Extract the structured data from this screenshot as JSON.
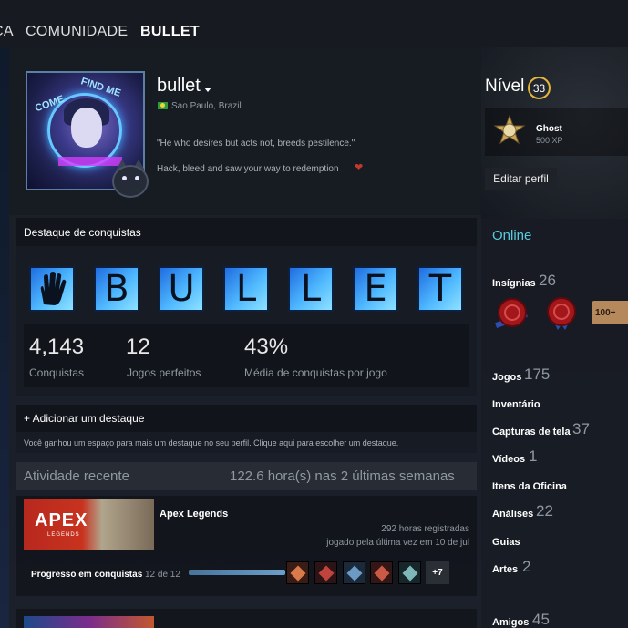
{
  "nav": {
    "item1": "CA",
    "item2": "COMUNIDADE",
    "item3": "BULLET"
  },
  "profile": {
    "username": "bullet",
    "location": "Sao Paulo, Brazil",
    "quote": "\"He who desires but acts not, breeds pestilence.\"",
    "summary_line": "Hack, bleed and saw your way to redemption"
  },
  "right": {
    "level_label": "Nível",
    "level": "33",
    "badge_name": "Ghost",
    "badge_xp": "500 XP",
    "edit_profile": "Editar perfil",
    "status": "Online",
    "badges_label": "Insígnias",
    "badges_count": "26",
    "badge_tag": "100+",
    "links": [
      {
        "label": "Jogos",
        "count": "175"
      },
      {
        "label": "Inventário",
        "count": ""
      },
      {
        "label": "Capturas de tela",
        "count": "37"
      },
      {
        "label": "Vídeos",
        "count": "1"
      },
      {
        "label": "Itens da Oficina",
        "count": ""
      },
      {
        "label": "Análises",
        "count": "22"
      },
      {
        "label": "Guias",
        "count": ""
      },
      {
        "label": "Artes",
        "count": "2"
      },
      {
        "label": "Amigos",
        "count": "45"
      }
    ]
  },
  "showcase": {
    "title": "Destaque de conquistas",
    "tiles": [
      "hand-icon",
      "B",
      "U",
      "L",
      "L",
      "E",
      "T"
    ],
    "stats": [
      {
        "value": "4,143",
        "label": "Conquistas"
      },
      {
        "value": "12",
        "label": "Jogos perfeitos"
      },
      {
        "value": "43%",
        "label": "Média de conquistas por jogo"
      }
    ]
  },
  "add_showcase": {
    "title": "+ Adicionar um destaque",
    "desc": "Você ganhou um espaço para mais um destaque no seu perfil. Clique aqui para escolher um destaque."
  },
  "recent": {
    "title": "Atividade recente",
    "hours": "122.6 hora(s) nas 2 últimas semanas",
    "game": {
      "name": "Apex Legends",
      "logo_word": "APEX",
      "logo_sub": "LEGENDS",
      "hours_on_record": "292 horas registradas",
      "last_played": "jogado pela última vez em 10 de jul",
      "ach_label": "Progresso em conquistas",
      "ach_count": "12 de 12",
      "ach_progress": 1.0,
      "ach_more": "+7"
    }
  },
  "colors": {
    "accent": "#57cbde",
    "level_ring": "#e3b53c",
    "panel": "#1b2838"
  }
}
